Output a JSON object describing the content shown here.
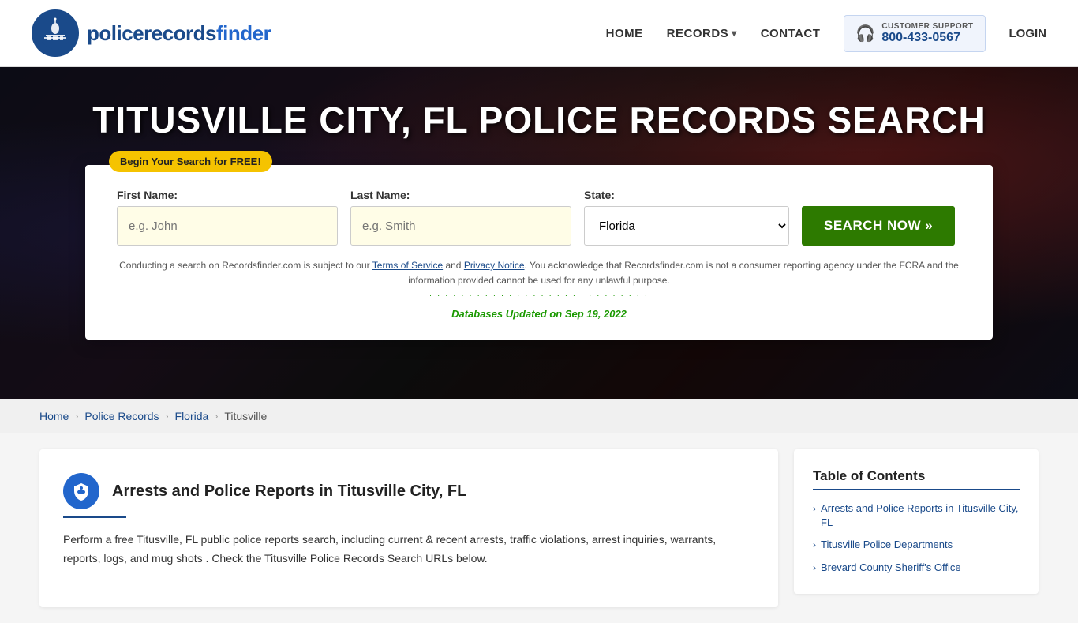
{
  "header": {
    "logo_text_main": "policerecords",
    "logo_text_bold": "finder",
    "nav": {
      "home_label": "HOME",
      "records_label": "RECORDS",
      "contact_label": "CONTACT",
      "support_label": "CUSTOMER SUPPORT",
      "support_number": "800-433-0567",
      "login_label": "LOGIN"
    }
  },
  "hero": {
    "title": "TITUSVILLE CITY, FL POLICE RECORDS SEARCH"
  },
  "search": {
    "free_badge": "Begin Your Search for FREE!",
    "first_name_label": "First Name:",
    "first_name_placeholder": "e.g. John",
    "last_name_label": "Last Name:",
    "last_name_placeholder": "e.g. Smith",
    "state_label": "State:",
    "state_value": "Florida",
    "search_button_label": "SEARCH NOW »",
    "disclaimer": "Conducting a search on Recordsfinder.com is subject to our Terms of Service and Privacy Notice. You acknowledge that Recordsfinder.com is not a consumer reporting agency under the FCRA and the information provided cannot be used for any unlawful purpose.",
    "terms_link": "Terms of Service",
    "privacy_link": "Privacy Notice",
    "db_updated_label": "Databases Updated on",
    "db_updated_date": "Sep 19, 2022"
  },
  "breadcrumb": {
    "home": "Home",
    "police_records": "Police Records",
    "florida": "Florida",
    "current": "Titusville"
  },
  "content": {
    "section_title": "Arrests and Police Reports in Titusville City, FL",
    "body_text": "Perform a free Titusville, FL public police reports search, including current & recent arrests, traffic violations, arrest inquiries, warrants, reports, logs, and mug shots . Check the Titusville Police Records Search URLs below."
  },
  "toc": {
    "title": "Table of Contents",
    "items": [
      {
        "label": "Arrests and Police Reports in Titusville City, FL",
        "link": "#"
      },
      {
        "label": "Titusville Police Departments",
        "link": "#"
      },
      {
        "label": "Brevard County Sheriff's Office",
        "link": "#"
      }
    ]
  }
}
